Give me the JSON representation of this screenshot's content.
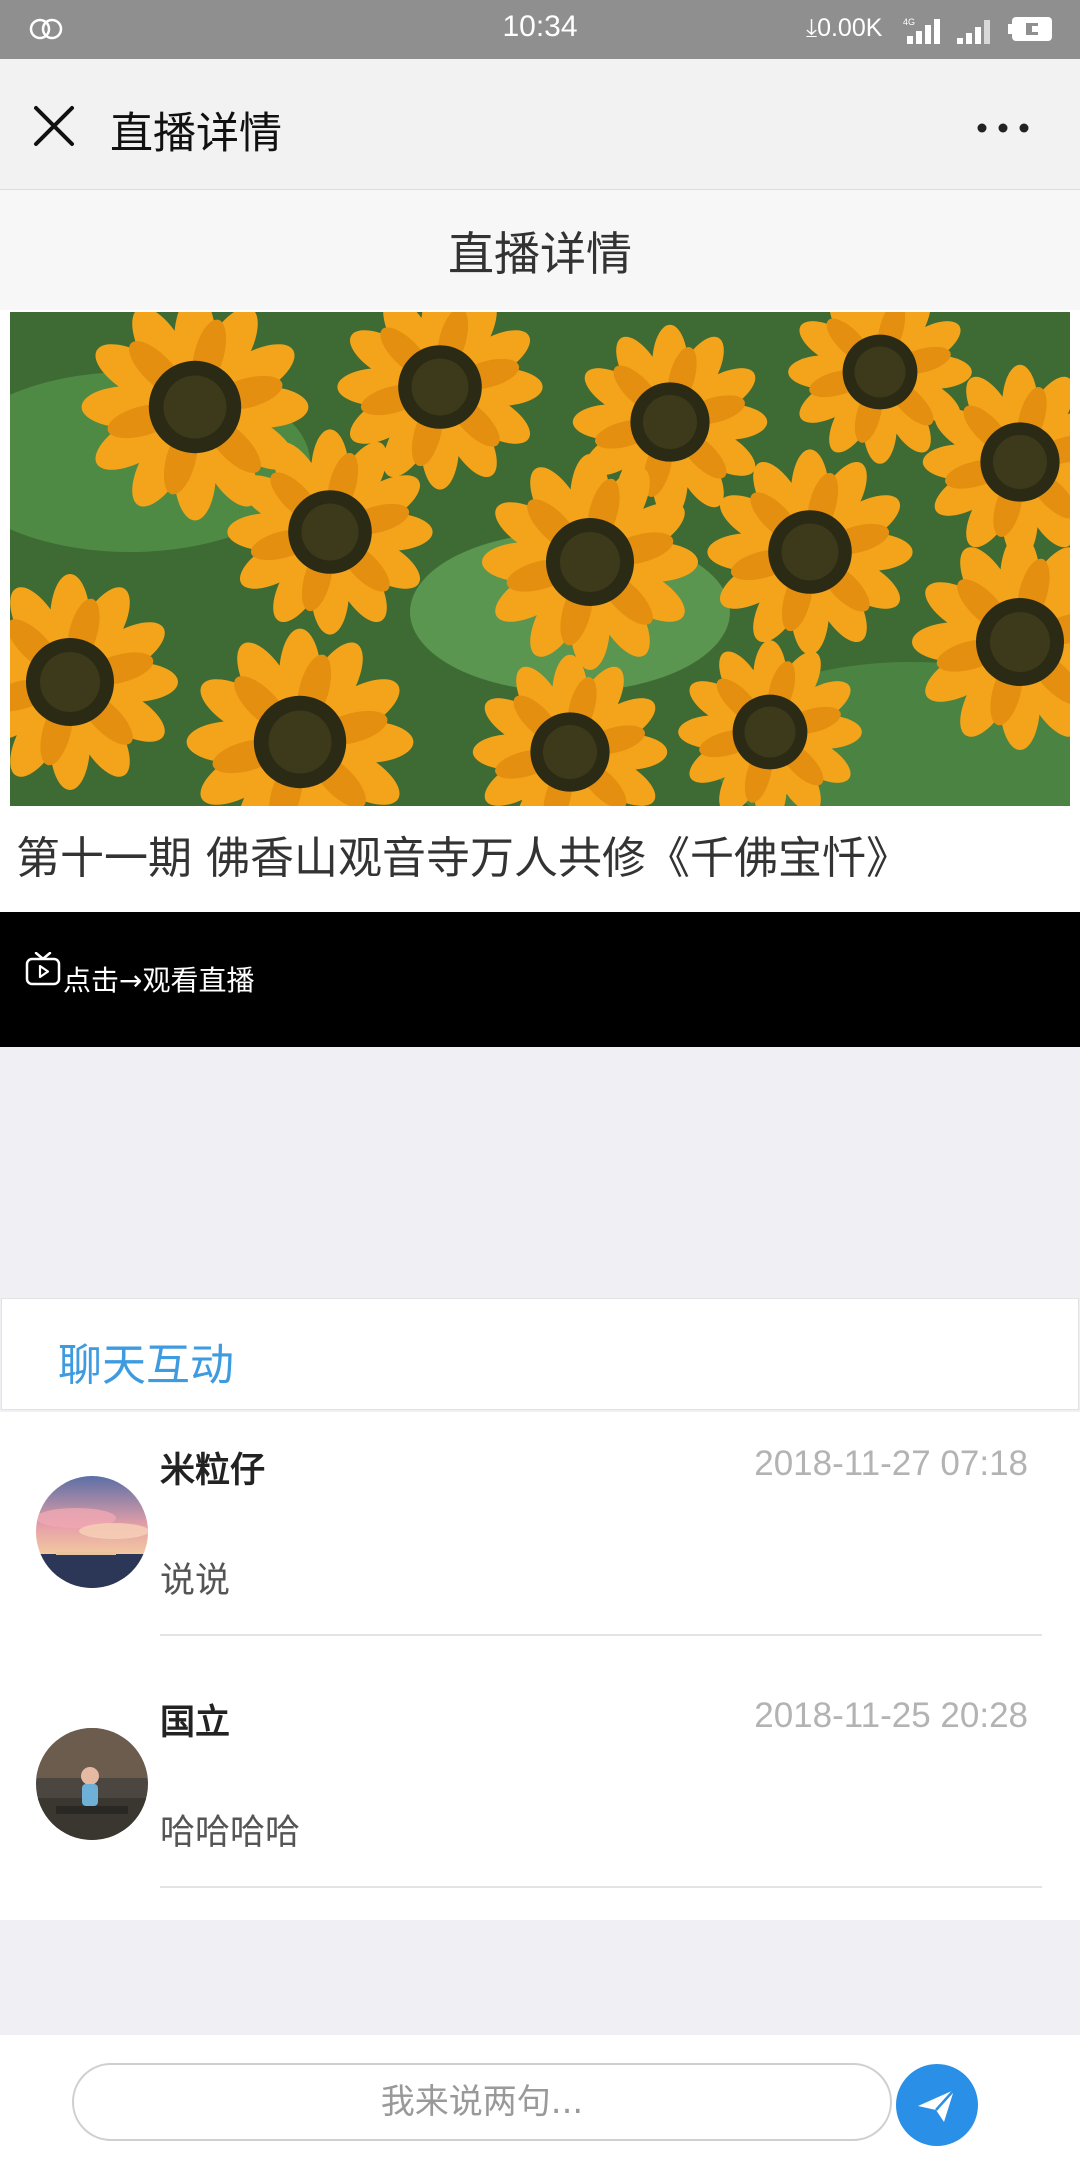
{
  "status_bar": {
    "time": "10:34",
    "network_speed": "0.00K",
    "signal_label": "4G"
  },
  "title_bar": {
    "title": "直播详情"
  },
  "page": {
    "header": "直播详情",
    "live_title": "第十一期 佛香山观音寺万人共修《千佛宝忏》",
    "watch_label": "点击→观看直播"
  },
  "chat": {
    "header": "聊天互动",
    "messages": [
      {
        "name": "米粒仔",
        "time": "2018-11-27 07:18",
        "text": "说说"
      },
      {
        "name": "国立",
        "time": "2018-11-25 20:28",
        "text": "哈哈哈哈"
      }
    ]
  },
  "input": {
    "placeholder": "我来说两句..."
  },
  "colors": {
    "accent": "#3f9be0",
    "send_button": "#2a8fe6",
    "status_bar": "#8f8f8f"
  }
}
